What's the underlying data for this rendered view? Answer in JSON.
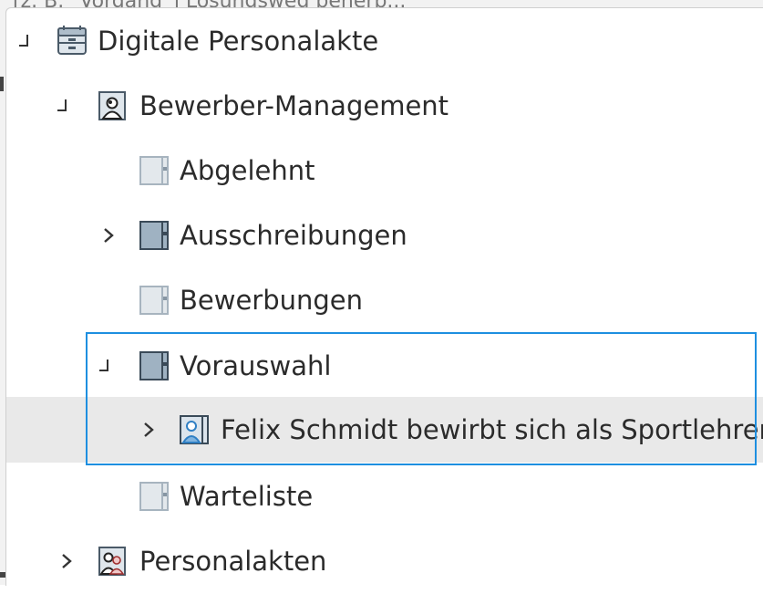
{
  "background": {
    "partial_title": "[z. B. \"Vorgang\"] Lösungsweg beherb..."
  },
  "tree": {
    "items": [
      {
        "label": "Digitale Personalakte",
        "icon": "archive-icon",
        "toggle": "collapse"
      },
      {
        "label": "Bewerber-Management",
        "icon": "person-folder-icon",
        "toggle": "collapse"
      },
      {
        "label": "Abgelehnt",
        "icon": "folder-light-icon",
        "toggle": "none"
      },
      {
        "label": "Ausschreibungen",
        "icon": "folder-dark-icon",
        "toggle": "expand"
      },
      {
        "label": "Bewerbungen",
        "icon": "folder-light-icon",
        "toggle": "none"
      },
      {
        "label": "Vorauswahl",
        "icon": "folder-dark-icon",
        "toggle": "collapse"
      },
      {
        "label": "Felix Schmidt bewirbt sich als Sportlehrer",
        "icon": "person-file-icon",
        "toggle": "expand"
      },
      {
        "label": "Warteliste",
        "icon": "folder-light-icon",
        "toggle": "none"
      },
      {
        "label": "Personalakten",
        "icon": "people-folder-icon",
        "toggle": "expand"
      }
    ]
  },
  "colors": {
    "selection_border": "#1e8fe0",
    "selection_background": "#e9e9e9",
    "folder_dark": "#9fb2c2",
    "folder_light": "#e3e8ec"
  }
}
